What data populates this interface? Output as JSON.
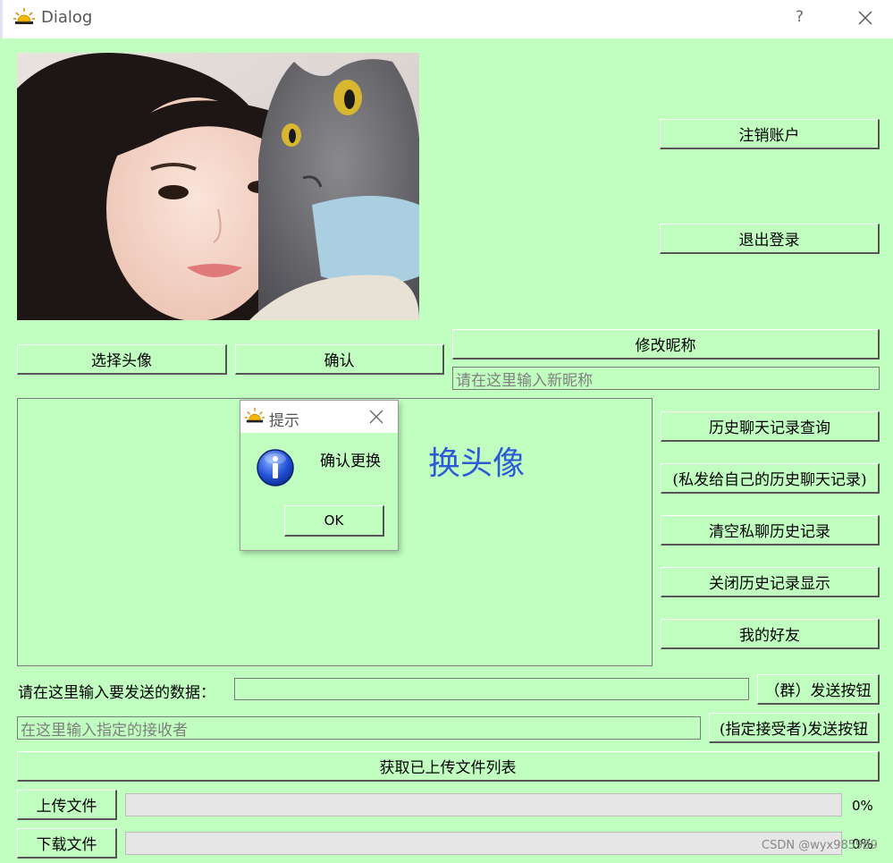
{
  "window": {
    "title": "Dialog",
    "help_label": "?"
  },
  "account": {
    "logout_account_label": "注销账户",
    "sign_out_label": "退出登录"
  },
  "avatar": {
    "choose_label": "选择头像",
    "confirm_label": "确认"
  },
  "nickname": {
    "modify_label": "修改昵称",
    "placeholder": "请在这里输入新昵称"
  },
  "chat_panel": {
    "overlay_text": "换头像"
  },
  "history": {
    "query_label": "历史聊天记录查询",
    "private_label": "(私发给自己的历史聊天记录)",
    "clear_label": "清空私聊历史记录",
    "close_label": "关闭历史记录显示",
    "friends_label": "我的好友"
  },
  "send": {
    "data_label": "请在这里输入要发送的数据：",
    "data_value": "",
    "group_send_label": "（群）发送按钮",
    "receiver_placeholder": "在这里输入指定的接收者",
    "direct_send_label": "(指定接受者)发送按钮"
  },
  "files": {
    "list_label": "获取已上传文件列表",
    "upload_label": "上传文件",
    "download_label": "下载文件",
    "upload_progress": 0,
    "download_progress": 0,
    "upload_pct_text": "0%",
    "download_pct_text": "0%"
  },
  "message_box": {
    "title": "提示",
    "text": "确认更换",
    "ok_label": "OK"
  },
  "watermark": "CSDN @wyx985989",
  "colors": {
    "background": "#c0ffc0",
    "accent_text": "#2d5bd6"
  }
}
